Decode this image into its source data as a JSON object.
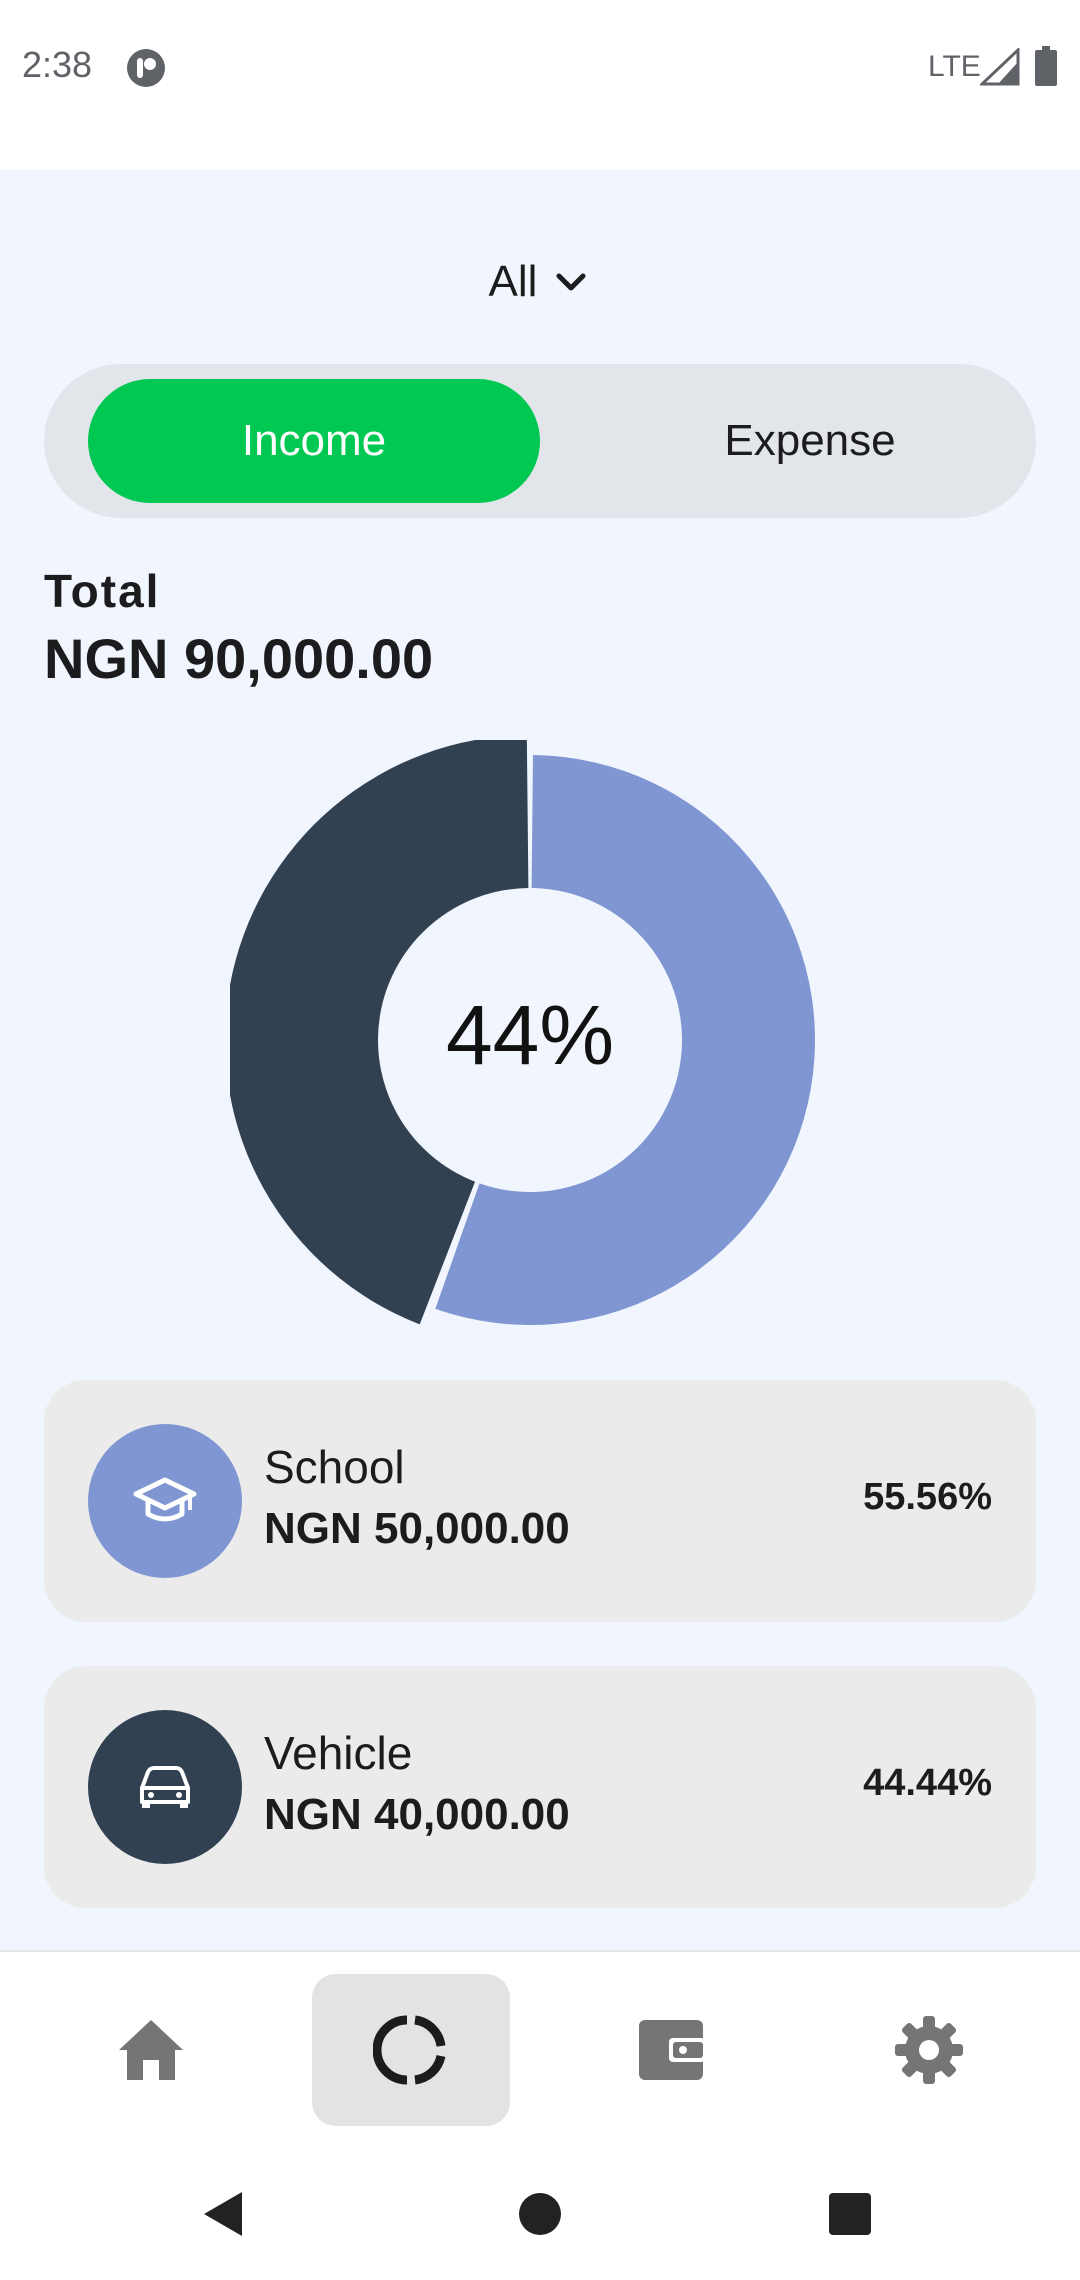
{
  "status_bar": {
    "time": "2:38",
    "network": "LTE",
    "icons": [
      "app-notification-icon",
      "signal-icon",
      "battery-icon"
    ]
  },
  "filter": {
    "label": "All",
    "icon": "chevron-down-icon"
  },
  "toggle": {
    "income_label": "Income",
    "expense_label": "Expense",
    "selected": "Income",
    "active_color": "#00c853"
  },
  "total": {
    "label": "Total",
    "value": "NGN 90,000.00"
  },
  "chart_data": {
    "type": "pie",
    "center_label": "44%",
    "slices": [
      {
        "name": "School",
        "value": 50000,
        "percent": 55.56,
        "color": "#7f96d2"
      },
      {
        "name": "Vehicle",
        "value": 40000,
        "percent": 44.44,
        "color": "#324152"
      }
    ]
  },
  "categories": [
    {
      "name": "School",
      "amount": "NGN 50,000.00",
      "percent": "55.56%",
      "icon": "graduation-cap-icon",
      "color": "#7f96d2"
    },
    {
      "name": "Vehicle",
      "amount": "NGN 40,000.00",
      "percent": "44.44%",
      "icon": "car-icon",
      "color": "#324152"
    }
  ],
  "bottom_nav": {
    "items": [
      {
        "icon": "home-icon",
        "active": false
      },
      {
        "icon": "analytics-icon",
        "active": true
      },
      {
        "icon": "wallet-icon",
        "active": false
      },
      {
        "icon": "gear-icon",
        "active": false
      }
    ]
  },
  "system_nav": {
    "icons": [
      "back-icon",
      "home-circle-icon",
      "recents-icon"
    ]
  }
}
